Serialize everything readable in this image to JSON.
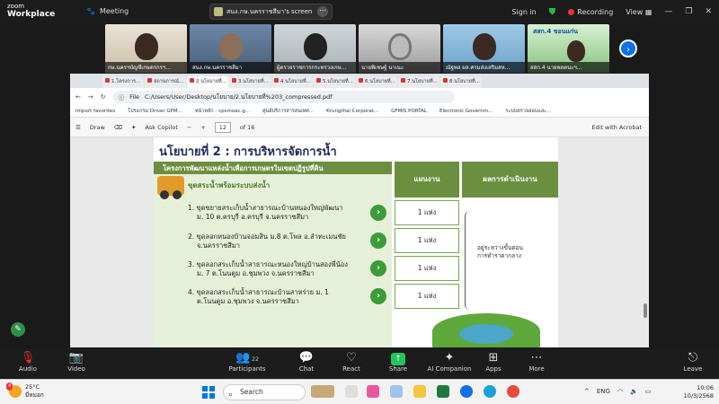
{
  "zoom": {
    "logo_line1": "zoom",
    "logo_line2": "Workplace",
    "meeting_label": "Meeting",
    "screen_share_label": "สนง.กษ.นครราชสีมา's screen",
    "sign_in": "Sign in",
    "recording": "Recording",
    "view": "View"
  },
  "participants": [
    {
      "name": "กษ.นครฯบัญชีเกษตรกรฯ..."
    },
    {
      "name": "สนง.กษ.นครราชสีมา"
    },
    {
      "name": "ผู้ตรวจราชการกระทรวงเกษ..."
    },
    {
      "name": "นายพิเชษฐ์ นาเนะ"
    },
    {
      "name": "ณัฐพล ผล.ศรมส่งเสริมสห..."
    },
    {
      "name": "สสก.4 นายพลตนะฯ..."
    }
  ],
  "participant_poster": "สสก.4 ขอนแก่น",
  "browser": {
    "tabs": [
      "1.โครงการ...",
      "สถานการณ์...",
      "2.นโยบายที่...",
      "3.นโยบายที่...",
      "4.นโยบายที่...",
      "5.นโยบายที่...",
      "6.นโยบายที่...",
      "7.นโยบายที่...",
      "8.นโยบายที่..."
    ],
    "file_label": "File",
    "url": "C:/Users/User/Desktop/นโยบาย/2.นโยบายที่%203_compressed.pdf",
    "bookmarks": [
      "Import favorites",
      "โปรแกรม Driver GFM...",
      "หน้าหลัก - cpsmoac.g...",
      "ศูนย์บริการสารสนเทศ...",
      "Krungthai Corporat...",
      "GFMIS PORTAL",
      "Electronic Governm...",
      "ระบบตรวจสอบและ..."
    ],
    "pdf_draw": "Draw",
    "pdf_ask": "Ask Copilot",
    "pdf_minus": "−",
    "pdf_plus": "+",
    "page_current": "12",
    "page_of": "of 16",
    "pdf_edit": "Edit with Acrobat"
  },
  "slide": {
    "title": "นโยบายที่ 2 : การบริหารจัดการน้ำ",
    "project_header": "โครงการพัฒนาแหล่งน้ำเพื่อการเกษตรในเขตปฏิรูปที่ดิน",
    "sub_header": "ขุดสระน้ำพร้อมระบบส่งน้ำ",
    "col_plan": "แผนงาน",
    "col_result": "ผลการดำเนินงาน",
    "items": [
      {
        "line1": "1. ขุดขยายสระเก็บน้ำสาธารณะบ้านหนองใหญ่พัฒนา",
        "line2": "ม. 10 ต.ครบุรี อ.ครบุรี จ.นครราชสีมา",
        "plan": "1 แห่ง"
      },
      {
        "line1": "2. ขุดลอกหนองบ้านจอมสิน ม.8 ต.โพล อ.ลำทะเมนชัย",
        "line2": "จ.นครราชสีมา",
        "plan": "1 แห่ง"
      },
      {
        "line1": "3. ขุดลอกสระเก็บน้ำสาธารณะหนองใหญ่บ้านสองพี่น้อง",
        "line2": "ม. 7 ต.โนนตูม อ.ชุมพวง จ.นครราชสีมา",
        "plan": "1 แห่ง"
      },
      {
        "line1": "4. ขุดลอกสระเก็บน้ำสาธารณะบ้านสาหร่าย ม. 1",
        "line2": "ต.โนนตูม อ.ชุมพวง จ.นครราชสีมา",
        "plan": "1 แห่ง"
      }
    ],
    "result_text_1": "อยู่ระหว่างขั้นตอน",
    "result_text_2": "การทำราคากลาง"
  },
  "toolbar": {
    "audio": "Audio",
    "video": "Video",
    "participants": "Participants",
    "participants_count": "22",
    "chat": "Chat",
    "react": "React",
    "share": "Share",
    "ai": "AI Companion",
    "apps": "Apps",
    "more": "More",
    "leave": "Leave"
  },
  "taskbar": {
    "temp": "25°C",
    "weather_desc": "มีหมอก",
    "weather_badge": "4",
    "search": "Search",
    "lang": "ENG",
    "time": "10:06",
    "date": "10/3/2568"
  }
}
